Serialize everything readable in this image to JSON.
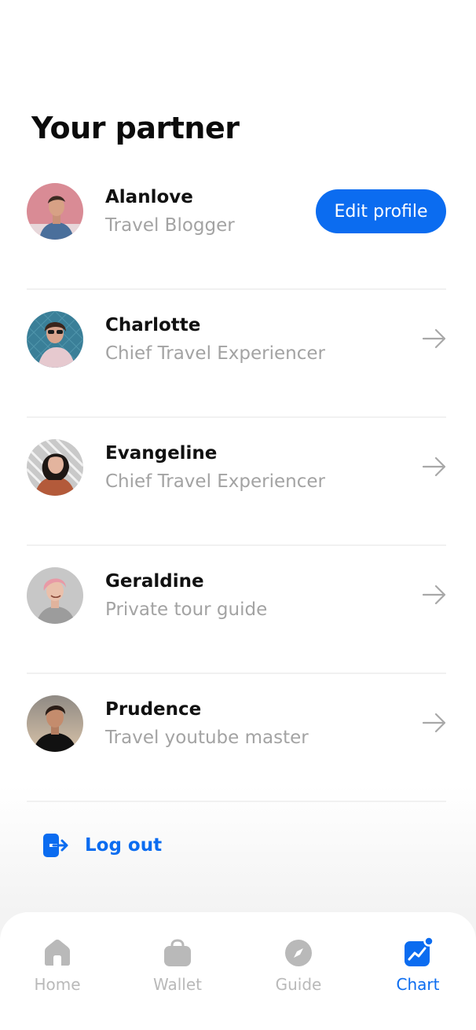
{
  "page": {
    "title": "Your partner"
  },
  "partners": [
    {
      "name": "Alanlove",
      "role": "Travel Blogger",
      "action": "Edit profile",
      "action_icon": "none"
    },
    {
      "name": "Charlotte",
      "role": "Chief Travel Experiencer",
      "action_icon": "arrow-right-icon"
    },
    {
      "name": "Evangeline",
      "role": "Chief Travel Experiencer",
      "action_icon": "arrow-right-icon"
    },
    {
      "name": "Geraldine",
      "role": "Private tour guide",
      "action_icon": "arrow-right-icon"
    },
    {
      "name": "Prudence",
      "role": "Travel youtube master",
      "action_icon": "arrow-right-icon"
    }
  ],
  "logout": {
    "label": "Log out",
    "icon": "logout-icon"
  },
  "tabbar": {
    "tabs": [
      {
        "label": "Home",
        "icon": "home-icon",
        "active": false
      },
      {
        "label": "Wallet",
        "icon": "wallet-icon",
        "active": false
      },
      {
        "label": "Guide",
        "icon": "compass-icon",
        "active": false
      },
      {
        "label": "Chart",
        "icon": "chart-icon",
        "active": true,
        "badge": true
      }
    ]
  },
  "colors": {
    "accent": "#0b6cf0",
    "inactive": "#b9b9b9",
    "secondary_text": "#a3a3a3",
    "divider": "#f1f1f1"
  }
}
